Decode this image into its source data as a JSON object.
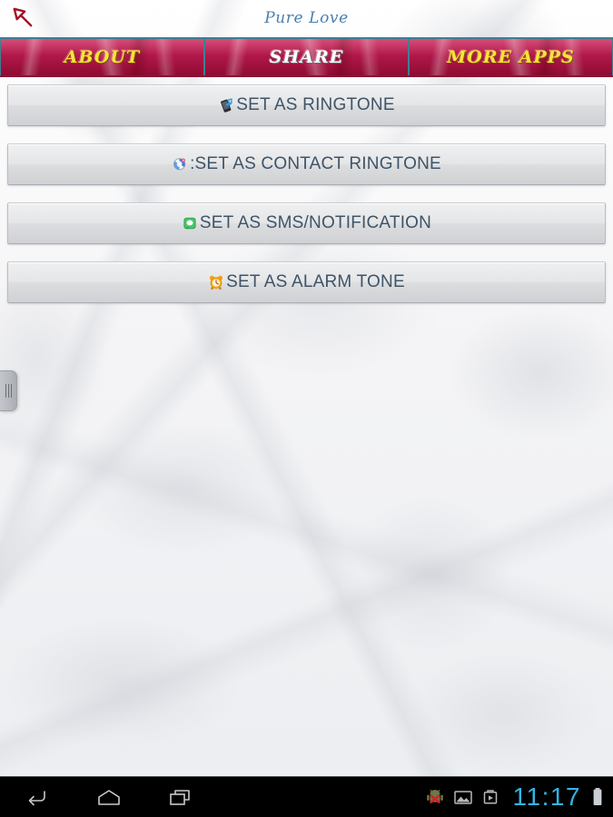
{
  "header": {
    "title": "Pure Love",
    "back_icon": "back-arrow-icon",
    "title_color": "#4a7fae"
  },
  "tabs": [
    {
      "label": "ABOUT",
      "style": "gold",
      "name": "tab-about"
    },
    {
      "label": "SHARE",
      "style": "silver",
      "name": "tab-share"
    },
    {
      "label": "MORE APPS",
      "style": "gold",
      "name": "tab-more-apps"
    }
  ],
  "actions": [
    {
      "label": "SET AS RINGTONE",
      "icon": "phone-music-note-icon",
      "name": "set-as-ringtone-button"
    },
    {
      "label": ":SET AS CONTACT RINGTONE",
      "icon": "contact-sync-icon",
      "name": "set-as-contact-ringtone-button"
    },
    {
      "label": "SET AS SMS/NOTIFICATION",
      "icon": "sms-bubble-icon",
      "name": "set-as-sms-notification-button"
    },
    {
      "label": "SET AS ALARM TONE",
      "icon": "alarm-clock-icon",
      "name": "set-as-alarm-tone-button"
    }
  ],
  "drawer": {
    "handle_icon": "drawer-grip-icon"
  },
  "systembar": {
    "back_icon": "android-back-icon",
    "home_icon": "android-home-icon",
    "recents_icon": "android-recents-icon",
    "status_icons": [
      "android-error-icon",
      "gallery-image-icon",
      "usb-transfer-icon"
    ],
    "clock": "11:17",
    "battery_icon": "battery-full-icon",
    "clock_color": "#33b5e5"
  },
  "theme": {
    "tab_red": "#b5184b",
    "tab_border_teal": "#3f8092",
    "button_text": "#3e5468",
    "gold": "#ffe13b"
  }
}
